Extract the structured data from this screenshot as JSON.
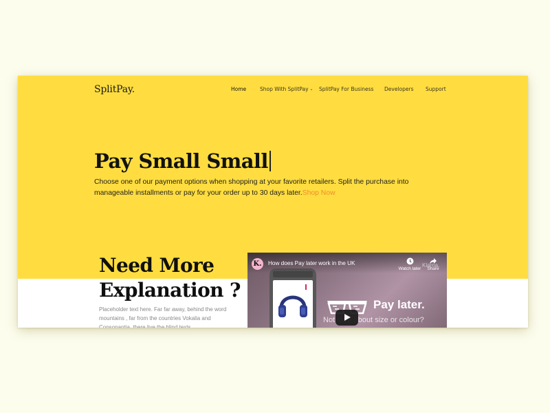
{
  "header": {
    "brand": "SplitPay.",
    "nav": [
      {
        "label": "Home"
      },
      {
        "label": "Shop With SplitPay"
      },
      {
        "label": "SplitPay For Business"
      },
      {
        "label": "Developers"
      },
      {
        "label": "Support"
      }
    ]
  },
  "hero": {
    "title": "Pay Small Small",
    "text": "Choose one of our payment options when shopping at your favorite retailers. Split the purchase into manageable installments or pay for your order up to 30 days later.",
    "link": "Shop Now"
  },
  "section": {
    "title_line1": "Need More",
    "title_line2": "Explanation ?",
    "text": "Placeholder text here. Far far away, behind the word mountains , far from the countries Vokalia and Consonantia, there live the blind texts."
  },
  "video": {
    "channel_initial": "K.",
    "title": "How does Pay later work in the UK",
    "watch_later": "Watch later",
    "share": "Share",
    "brand_tag": "Klarna.",
    "headline": "Pay later.",
    "subline": "Not sure about size or colour?"
  },
  "colors": {
    "hero_bg": "#ffdd40",
    "page_bg": "#fdfdee",
    "accent_link": "#f28c28",
    "klarna_pink": "#f5b6cd"
  },
  "icons": {
    "clock": "clock-icon",
    "share": "share-icon",
    "play": "play-icon",
    "chevron": "chevron-down-icon"
  }
}
